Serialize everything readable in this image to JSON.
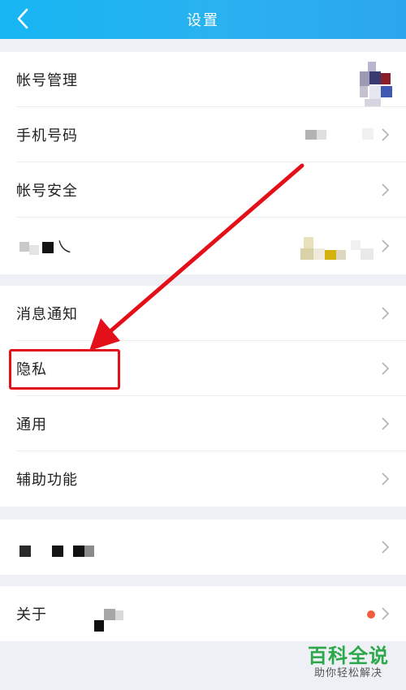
{
  "header": {
    "title": "设置"
  },
  "rows": {
    "account": "帐号管理",
    "phone": "手机号码",
    "security": "帐号安全",
    "hidden_label_suffix": "乀",
    "notifications": "消息通知",
    "privacy": "隐私",
    "general": "通用",
    "accessibility": "辅助功能",
    "about": "关于"
  },
  "watermark": {
    "title": "百科全说",
    "subtitle": "助你轻松解决"
  },
  "colors": {
    "header": "#29b3f1",
    "annotation_red": "#e3101a",
    "badge": "#f25c3f",
    "brand_green": "#2ba84a"
  },
  "icons": {
    "back": "chevron-left-icon",
    "row_arrow": "chevron-right-icon"
  }
}
